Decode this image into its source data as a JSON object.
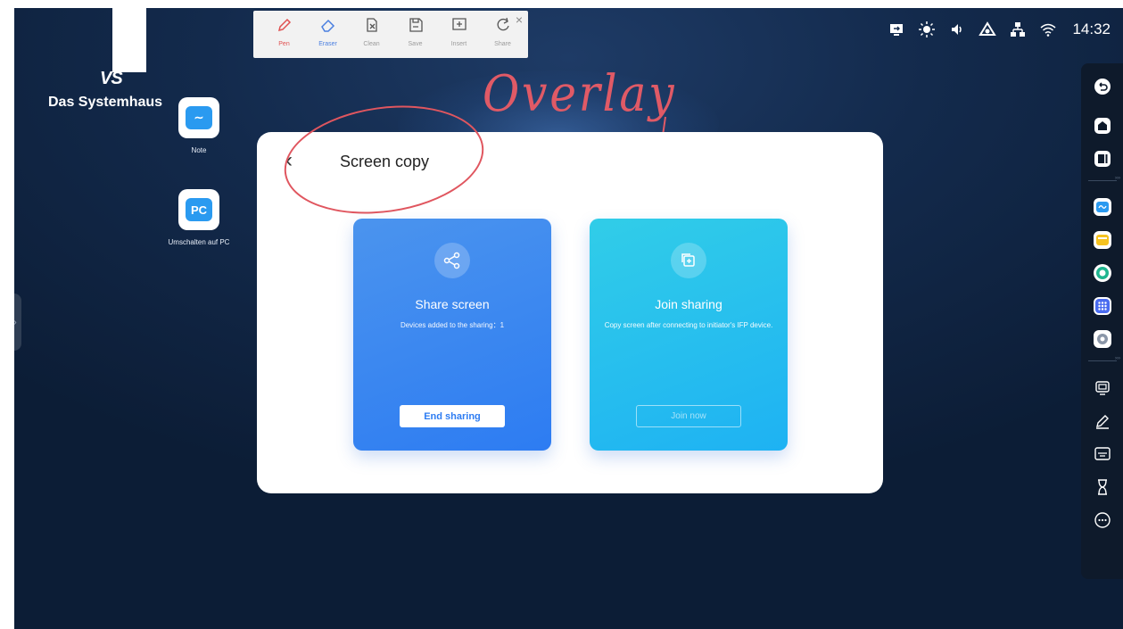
{
  "logo": {
    "mark": "VS",
    "company": "Das Systemhaus"
  },
  "desktop": {
    "icons": [
      {
        "name": "note",
        "label": "Note",
        "glyph": "∼"
      },
      {
        "name": "pc",
        "label": "Umschalten auf PC",
        "glyph": "PC"
      }
    ],
    "edge_tab": "›"
  },
  "toolbar": {
    "tools": [
      {
        "name": "pen",
        "label": "Pen"
      },
      {
        "name": "eraser",
        "label": "Eraser"
      },
      {
        "name": "clean",
        "label": "Clean"
      },
      {
        "name": "save",
        "label": "Save"
      },
      {
        "name": "insert",
        "label": "Insert"
      },
      {
        "name": "share",
        "label": "Share"
      }
    ],
    "close": "×"
  },
  "status_bar": {
    "icons": [
      "screen-mirror-icon",
      "brightness-icon",
      "volume-icon",
      "hotspot-icon",
      "network-icon",
      "wifi-icon"
    ],
    "time": "14:32"
  },
  "annotation": {
    "text": "Overlay",
    "color": "#e05a66"
  },
  "dialog": {
    "back": "‹",
    "title": "Screen copy",
    "cards": {
      "share": {
        "title": "Share screen",
        "subtitle": "Devices added to the sharing：1",
        "button": "End sharing",
        "color": "#2d7cf2"
      },
      "join": {
        "title": "Join sharing",
        "subtitle": "Copy screen after connecting to initiator's IFP device.",
        "button": "Join now",
        "color": "#1eb2f3"
      }
    }
  },
  "sidebar": {
    "items": [
      "back-icon",
      "home-icon",
      "recent-apps-icon",
      "note-app-icon",
      "files-app-icon",
      "browser-app-icon",
      "apps-grid-icon",
      "settings-icon",
      "screen-share-icon",
      "annotate-icon",
      "whiteboard-icon",
      "timer-icon",
      "more-icon"
    ]
  },
  "colors": {
    "accent_blue": "#2d7cf2",
    "accent_cyan": "#1eb2f3",
    "annotation_red": "#e05a66",
    "background": "#132a4c"
  }
}
